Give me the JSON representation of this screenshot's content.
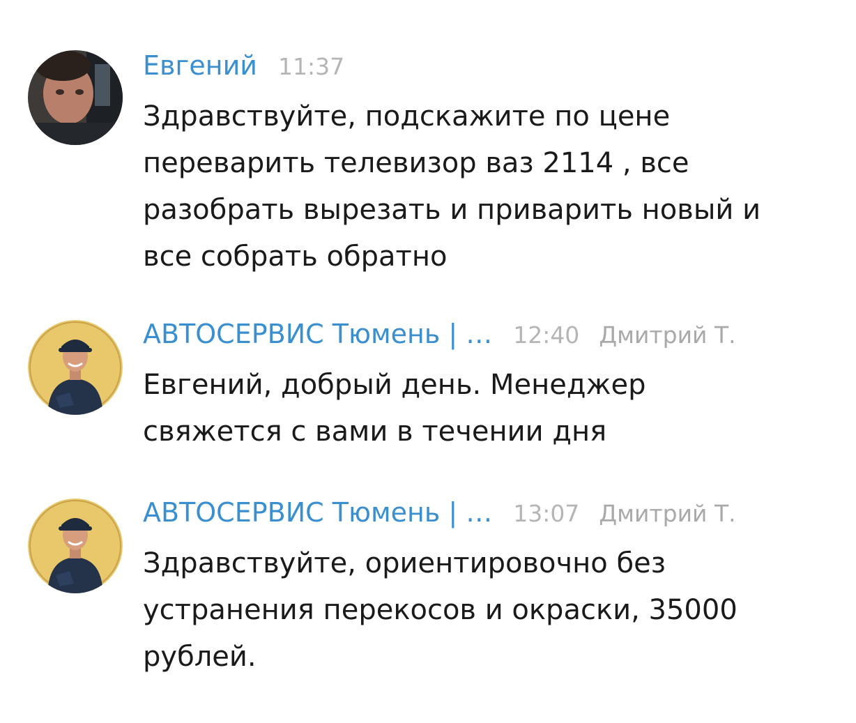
{
  "messages": [
    {
      "author": "Евгений",
      "time": "11:37",
      "signer": "",
      "text": "Здравствуйте, подскажите по цене\nпереварить телевизор ваз 2114 , все\nразобрать вырезать и приварить новый и\nвсе собрать обратно"
    },
    {
      "author": "АВТОСЕРВИС Тюмень | …",
      "time": "12:40",
      "signer": "Дмитрий Т.",
      "text": "Евгений, добрый день. Менеджер\nсвяжется с вами в течении дня"
    },
    {
      "author": "АВТОСЕРВИС Тюмень | …",
      "time": "13:07",
      "signer": "Дмитрий Т.",
      "text": "Здравствуйте, ориентировочно без\nустранения перекосов и окраски, 35000\nрублей."
    }
  ],
  "colors": {
    "author": "#3a8fd0",
    "time": "#b5b5b5",
    "text": "#1a1a1a",
    "service_avatar_bg": "#e8c86a"
  }
}
